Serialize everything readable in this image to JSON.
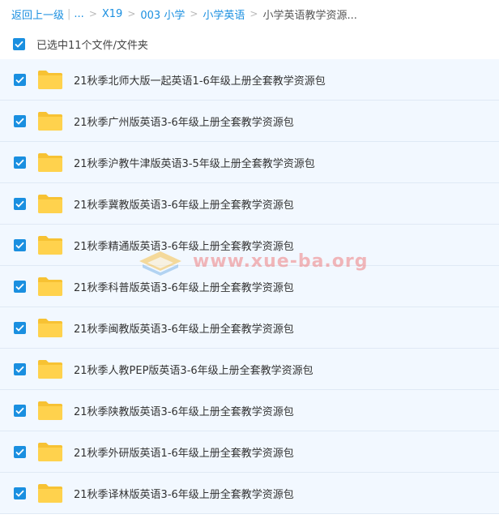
{
  "breadcrumb": {
    "back_label": "返回上一级",
    "divider": "|",
    "ellipsis": "...",
    "sep": ">",
    "items": [
      "X19",
      "003 小学",
      "小学英语"
    ],
    "current": "小学英语教学资源..."
  },
  "selection": {
    "label": "已选中11个文件/文件夹"
  },
  "files": [
    "21秋季北师大版一起英语1-6年级上册全套教学资源包",
    "21秋季广州版英语3-6年级上册全套教学资源包",
    "21秋季沪教牛津版英语3-5年级上册全套教学资源包",
    "21秋季冀教版英语3-6年级上册全套教学资源包",
    "21秋季精通版英语3-6年级上册全套教学资源包",
    "21秋季科普版英语3-6年级上册全套教学资源包",
    "21秋季闽教版英语3-6年级上册全套教学资源包",
    "21秋季人教PEP版英语3-6年级上册全套教学资源包",
    "21秋季陕教版英语3-6年级上册全套教学资源包",
    "21秋季外研版英语1-6年级上册全套教学资源包",
    "21秋季译林版英语3-6年级上册全套教学资源包"
  ],
  "watermark": {
    "text": "www.xue-ba.org"
  },
  "colors": {
    "accent": "#1a8fe0",
    "row_bg": "#f2f8ff",
    "folder": "#ffd045"
  },
  "icons": {
    "checkbox": "checkbox-checked-icon",
    "folder": "folder-icon"
  }
}
